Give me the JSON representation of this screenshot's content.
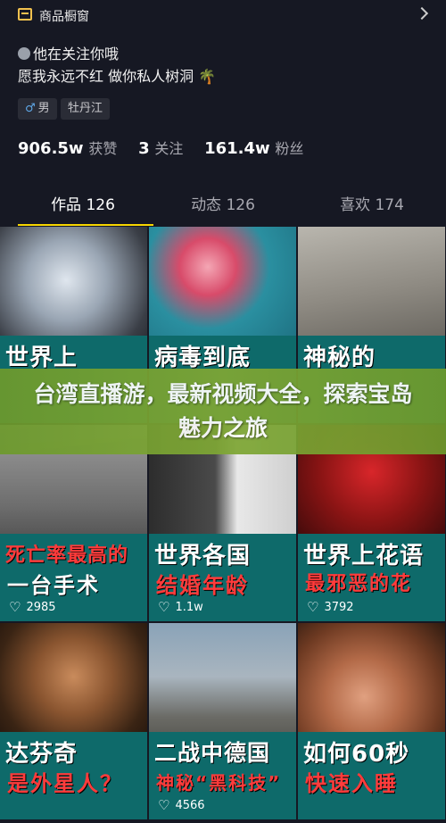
{
  "topbar": {
    "shop_label": "商品橱窗",
    "shop_icon": "shop-icon",
    "chevron_icon": "chevron-right-icon"
  },
  "bio": {
    "line1": "他在关注你哦",
    "line2": "愿我永远不红 做你私人树洞",
    "line2_emoji": "🌴"
  },
  "tags": {
    "gender": "男",
    "location": "牡丹江"
  },
  "stats": {
    "likes_num": "906.5w",
    "likes_label": "获赞",
    "following_num": "3",
    "following_label": "关注",
    "fans_num": "161.4w",
    "fans_label": "粉丝"
  },
  "tabs": [
    {
      "label": "作品 126"
    },
    {
      "label": "动态 126"
    },
    {
      "label": "喜欢 174"
    }
  ],
  "banner": {
    "text": "台湾直播游，最新视频大全，探索宝岛魅力之旅"
  },
  "colors": {
    "accent": "#f7d600",
    "background": "#161823",
    "banner": "#7fa735"
  },
  "videos": [
    {
      "cap1": "世界上",
      "cap2": "",
      "likes": ""
    },
    {
      "cap1": "病毒到底",
      "cap2": "",
      "likes": ""
    },
    {
      "cap1": "神秘的",
      "cap2": "",
      "likes": ""
    },
    {
      "cap1": "死亡率最高的",
      "cap2": "一台手术",
      "likes": "2985"
    },
    {
      "cap1": "世界各国",
      "cap2": "结婚年龄",
      "likes": "1.1w"
    },
    {
      "cap1": "世界上花语",
      "cap2": "最邪恶的花",
      "likes": "3792"
    },
    {
      "cap1": "达芬奇",
      "cap2": "是外星人？",
      "likes": ""
    },
    {
      "cap1": "二战中德国",
      "cap2": "神秘“黑科技”",
      "likes": "4566"
    },
    {
      "cap1": "如何60秒",
      "cap2": "快速入睡",
      "likes": ""
    }
  ]
}
